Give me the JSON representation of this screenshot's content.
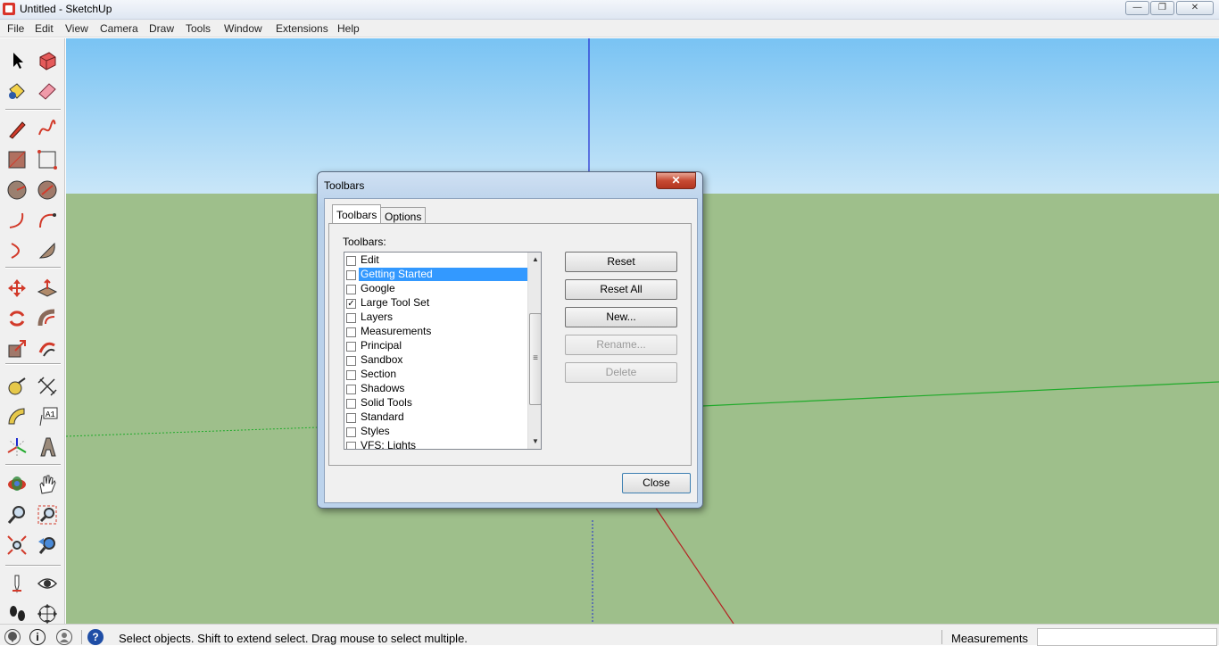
{
  "window": {
    "title": "Untitled - SketchUp",
    "minimize": "—",
    "maximize": "❐",
    "close": "✕"
  },
  "menu": [
    "File",
    "Edit",
    "View",
    "Camera",
    "Draw",
    "Tools",
    "Window",
    "Extensions",
    "Help"
  ],
  "toolbar": {
    "tools": [
      "select-tool",
      "make-component-tool",
      "paint-bucket-tool",
      "eraser-tool",
      "line-tool",
      "freehand-tool",
      "rectangle-tool",
      "rotated-rectangle-tool",
      "circle-tool",
      "polygon-tool",
      "arc-tool",
      "two-point-arc-tool",
      "three-point-arc-tool",
      "pie-tool",
      "move-tool",
      "push-pull-tool",
      "rotate-tool",
      "follow-me-tool",
      "scale-tool",
      "offset-tool",
      "tape-measure-tool",
      "dimension-tool",
      "protractor-tool",
      "text-tool",
      "axes-tool",
      "3d-text-tool",
      "orbit-tool",
      "pan-tool",
      "zoom-tool",
      "zoom-window-tool",
      "zoom-extents-tool",
      "previous-view-tool",
      "position-camera-tool",
      "look-around-tool",
      "walk-tool",
      "section-plane-tool"
    ],
    "text_tool_label": "A1"
  },
  "dialog": {
    "title": "Toolbars",
    "close": "✕",
    "tabs": [
      "Toolbars",
      "Options"
    ],
    "list_label": "Toolbars:",
    "items": [
      {
        "label": "Edit",
        "checked": false,
        "selected": false
      },
      {
        "label": "Getting Started",
        "checked": false,
        "selected": true
      },
      {
        "label": "Google",
        "checked": false,
        "selected": false
      },
      {
        "label": "Large Tool Set",
        "checked": true,
        "selected": false
      },
      {
        "label": "Layers",
        "checked": false,
        "selected": false
      },
      {
        "label": "Measurements",
        "checked": false,
        "selected": false
      },
      {
        "label": "Principal",
        "checked": false,
        "selected": false
      },
      {
        "label": "Sandbox",
        "checked": false,
        "selected": false
      },
      {
        "label": "Section",
        "checked": false,
        "selected": false
      },
      {
        "label": "Shadows",
        "checked": false,
        "selected": false
      },
      {
        "label": "Solid Tools",
        "checked": false,
        "selected": false
      },
      {
        "label": "Standard",
        "checked": false,
        "selected": false
      },
      {
        "label": "Styles",
        "checked": false,
        "selected": false
      },
      {
        "label": "VFS: Lights",
        "checked": false,
        "selected": false
      }
    ],
    "checkmark": "✓",
    "scroll_up": "▲",
    "scroll_down": "▼",
    "scroll_grip": "≡",
    "buttons": {
      "reset": "Reset",
      "reset_all": "Reset All",
      "new": "New...",
      "rename": "Rename...",
      "delete": "Delete"
    },
    "close_button": "Close"
  },
  "status": {
    "message": "Select objects. Shift to extend select. Drag mouse to select multiple.",
    "help_icon": "?",
    "info_icon": "i",
    "measurements_label": "Measurements",
    "measurements_value": ""
  },
  "colors": {
    "sky_top": "#79c3f3",
    "ground": "#9ebf8b",
    "axis_blue": "#1e2ad0",
    "axis_green": "#1faa2a",
    "axis_red": "#b32222",
    "selection": "#3399ff"
  }
}
